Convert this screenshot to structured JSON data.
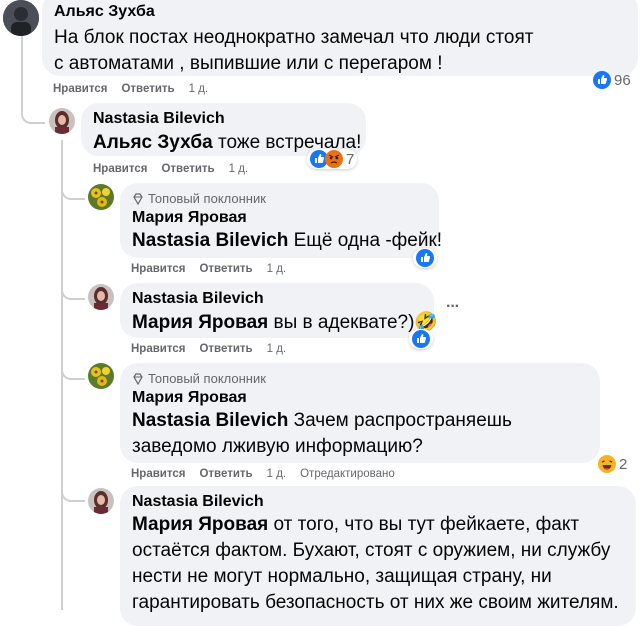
{
  "comments": [
    {
      "author": "Альяс Зухба",
      "text": "На блок постах неоднократно замечал что люди стоят с автоматами , выпившие или с перегаром !",
      "like": "Нравится",
      "reply": "Ответить",
      "time": "1 д.",
      "reactions": {
        "count": "96",
        "icons": [
          "like-reaction-icon"
        ]
      }
    },
    {
      "author": "Nastasia Bilevich",
      "mention": "Альяс Зухба",
      "text": " тоже встречала!",
      "like": "Нравится",
      "reply": "Ответить",
      "time": "1 д.",
      "reactions": {
        "count": "7",
        "icons": [
          "like-reaction-icon",
          "angry-reaction-icon"
        ]
      }
    },
    {
      "badge": "Топовый поклонник",
      "author": "Мария Яровая",
      "mention": "Nastasia Bilevich",
      "text": " Ещё одна -фейк!",
      "like": "Нравится",
      "reply": "Ответить",
      "time": "1 д.",
      "reactions": {
        "icons": [
          "like-reaction-icon"
        ]
      }
    },
    {
      "author": "Nastasia Bilevich",
      "mention": "Мария Яровая",
      "text": " вы в адеквате?)🤣",
      "like": "Нравится",
      "reply": "Ответить",
      "time": "1 д.",
      "more": "···",
      "reactions": {
        "icons": [
          "like-reaction-icon"
        ]
      }
    },
    {
      "badge": "Топовый поклонник",
      "author": "Мария Яровая",
      "mention": "Nastasia Bilevich",
      "text": " Зачем распространяешь заведомо лживую информацию?",
      "like": "Нравится",
      "reply": "Ответить",
      "time": "1 д.",
      "edited": "Отредактировано",
      "reactions": {
        "count": "2",
        "icons": [
          "haha-reaction-icon"
        ]
      }
    },
    {
      "author": "Nastasia Bilevich",
      "mention": "Мария Яровая",
      "text": " от того, что вы тут фейкаете, факт остаётся фактом. Бухают, стоят с оружием, ни службу нести не могут нормально, защищая страну, ни гарантировать безопасность от них же своим жителям."
    }
  ],
  "colors": {
    "bubble": "#f0f2f5",
    "like_blue": "#1877f2",
    "angry": "#e9710f",
    "haha": "#f7b125",
    "secondary_text": "#65676b"
  }
}
